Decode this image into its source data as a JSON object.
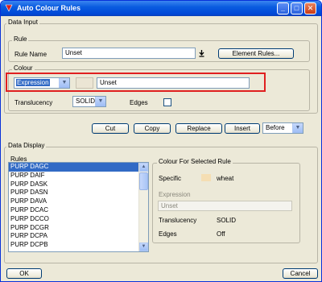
{
  "window": {
    "title": "Auto Colour Rules",
    "min_label": "_",
    "max_label": "□",
    "close_label": "✕"
  },
  "data_input": {
    "label": "Data Input",
    "rule": {
      "label": "Rule",
      "rule_name_label": "Rule Name",
      "rule_name_value": "Unset",
      "element_rules_label": "Element Rules..."
    },
    "colour": {
      "label": "Colour",
      "type_value": "Expression",
      "expression_value": "Unset",
      "translucency_label": "Translucency",
      "translucency_value": "SOLID",
      "edges_label": "Edges",
      "highlight_color": "#e02020"
    },
    "actions": {
      "cut": "Cut",
      "copy": "Copy",
      "replace": "Replace",
      "insert": "Insert",
      "position_value": "Before"
    }
  },
  "data_display": {
    "label": "Data Display",
    "rules_label": "Rules",
    "rules": [
      "PURP DAGC",
      "PURP DAIF",
      "PURP DASK",
      "PURP DASN",
      "PURP DAVA",
      "PURP DCAC",
      "PURP DCCO",
      "PURP DCGR",
      "PURP DCPA",
      "PURP DCPB"
    ],
    "selected_index": 0,
    "selected_colour": {
      "label": "Colour For Selected Rule",
      "specific_label": "Specific",
      "specific_value": "wheat",
      "specific_color": "#f5deb3",
      "expression_label": "Expression",
      "expression_value": "Unset",
      "translucency_label": "Translucency",
      "translucency_value": "SOLID",
      "edges_label": "Edges",
      "edges_value": "Off"
    }
  },
  "footer": {
    "ok": "OK",
    "cancel": "Cancel"
  }
}
